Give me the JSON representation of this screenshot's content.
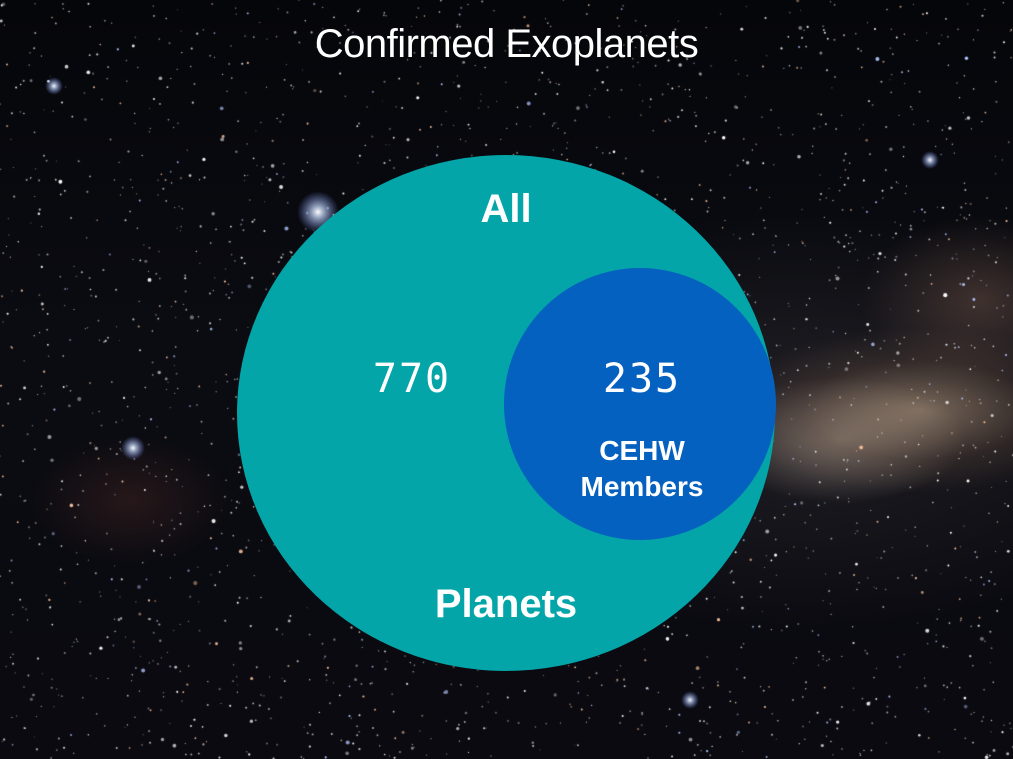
{
  "title": "Confirmed Exoplanets",
  "diagram": {
    "outer_label_top": "All",
    "outer_label_bottom": "Planets",
    "outer_count": "770",
    "inner_count": "235",
    "inner_label_line1": "CEHW",
    "inner_label_line2": "Members"
  },
  "colors": {
    "outer_circle": "#03a5a8",
    "inner_circle": "#0561bf",
    "text": "#ffffff",
    "background": "#07080d"
  }
}
